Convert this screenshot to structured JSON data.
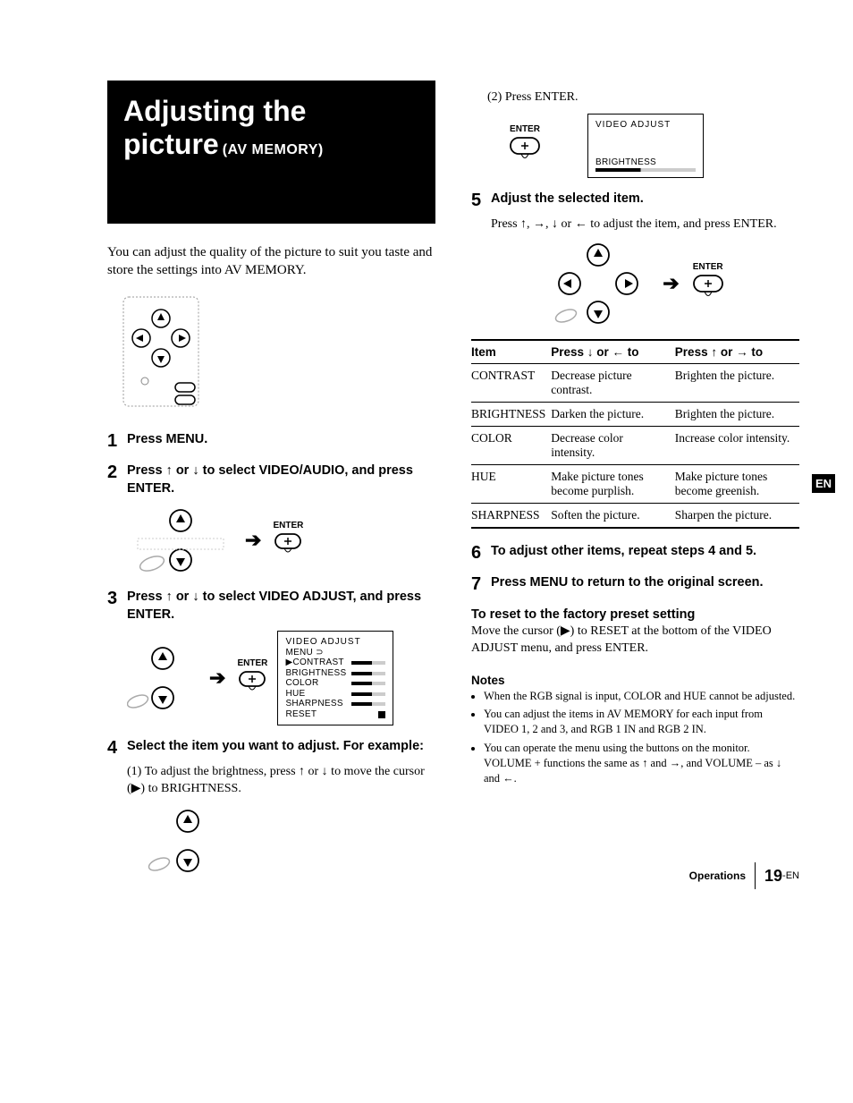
{
  "title": {
    "line1": "Adjusting the",
    "line2": "picture",
    "sub": "(AV MEMORY)"
  },
  "intro": "You can adjust the quality of the picture to suit you taste and store the settings into AV MEMORY.",
  "steps_left": {
    "s1": {
      "num": "1",
      "text": "Press MENU."
    },
    "s2": {
      "num": "2",
      "text": "Press ↑ or ↓ to select VIDEO/AUDIO, and press ENTER."
    },
    "s3": {
      "num": "3",
      "text": "Press ↑ or ↓ to select VIDEO ADJUST, and press ENTER."
    },
    "s4": {
      "num": "4",
      "text": "Select the item you want to adjust. For example:",
      "sub1": "(1) To adjust the brightness, press ↑ or ↓ to move the cursor (▶) to BRIGHTNESS."
    }
  },
  "steps_right": {
    "s4b": "(2) Press ENTER.",
    "s5": {
      "num": "5",
      "text": "Adjust the selected item.",
      "body": "Press ↑, →, ↓ or ← to adjust the item, and press ENTER."
    },
    "s6": {
      "num": "6",
      "text": "To adjust other items, repeat steps 4 and 5."
    },
    "s7": {
      "num": "7",
      "text": "Press MENU to return to the original screen."
    }
  },
  "osd": {
    "title": "VIDEO ADJUST",
    "menu_label": "MENU ⊃",
    "items": [
      "CONTRAST",
      "BRIGHTNESS",
      "COLOR",
      "HUE",
      "SHARPNESS",
      "RESET"
    ],
    "brightness_only": "BRIGHTNESS"
  },
  "enter_label": "ENTER",
  "table": {
    "head": [
      "Item",
      "Press ↓ or ← to",
      "Press ↑ or → to"
    ],
    "rows": [
      [
        "CONTRAST",
        "Decrease picture contrast.",
        "Brighten the picture."
      ],
      [
        "BRIGHTNESS",
        "Darken the picture.",
        "Brighten the picture."
      ],
      [
        "COLOR",
        "Decrease color intensity.",
        "Increase color intensity."
      ],
      [
        "HUE",
        "Make picture tones become purplish.",
        "Make picture tones become greenish."
      ],
      [
        "SHARPNESS",
        "Soften the picture.",
        "Sharpen the picture."
      ]
    ]
  },
  "reset": {
    "head": "To reset to the factory preset setting",
    "body": "Move the cursor (▶) to RESET at the bottom of the VIDEO ADJUST menu, and press ENTER."
  },
  "notes_head": "Notes",
  "notes": [
    "When the RGB signal is input, COLOR and HUE cannot be adjusted.",
    "You can adjust the items in AV MEMORY for each input from VIDEO 1, 2 and 3, and RGB 1 IN and RGB 2 IN.",
    "You can operate the menu using the buttons on the monitor. VOLUME + functions the same as ↑ and →, and VOLUME – as ↓ and ←."
  ],
  "en_tab": "EN",
  "footer": {
    "section": "Operations",
    "page": "19",
    "suffix": "-EN"
  }
}
